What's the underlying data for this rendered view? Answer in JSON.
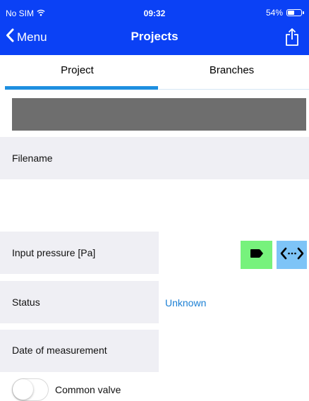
{
  "status_bar": {
    "carrier": "No SIM",
    "wifi_icon": "wifi-icon",
    "time": "09:32",
    "battery_percent": "54%",
    "battery_level": 0.54
  },
  "nav": {
    "back_label": "Menu",
    "back_icon": "chevron-left-icon",
    "title": "Projects",
    "share_icon": "share-icon"
  },
  "tabs": [
    {
      "label": "Project",
      "selected": true
    },
    {
      "label": "Branches",
      "selected": false
    }
  ],
  "form": {
    "filename_label": "Filename",
    "input_pressure_label": "Input pressure [Pa]",
    "status_label": "Status",
    "status_value": "Unknown",
    "date_label": "Date of measurement",
    "common_valve_label": "Common valve",
    "common_valve_on": false
  },
  "actions": {
    "tag_icon": "tag-icon",
    "connect_icon": "code-arrows-icon"
  },
  "colors": {
    "nav_bar": "#0b41f5",
    "tab_indicator": "#1e8fe0",
    "row_background": "#efeff4",
    "header_gray": "#6e6e6e",
    "status_value": "#1a7fd4",
    "green_button": "#77f27c",
    "blue_button": "#7ec4f7"
  }
}
